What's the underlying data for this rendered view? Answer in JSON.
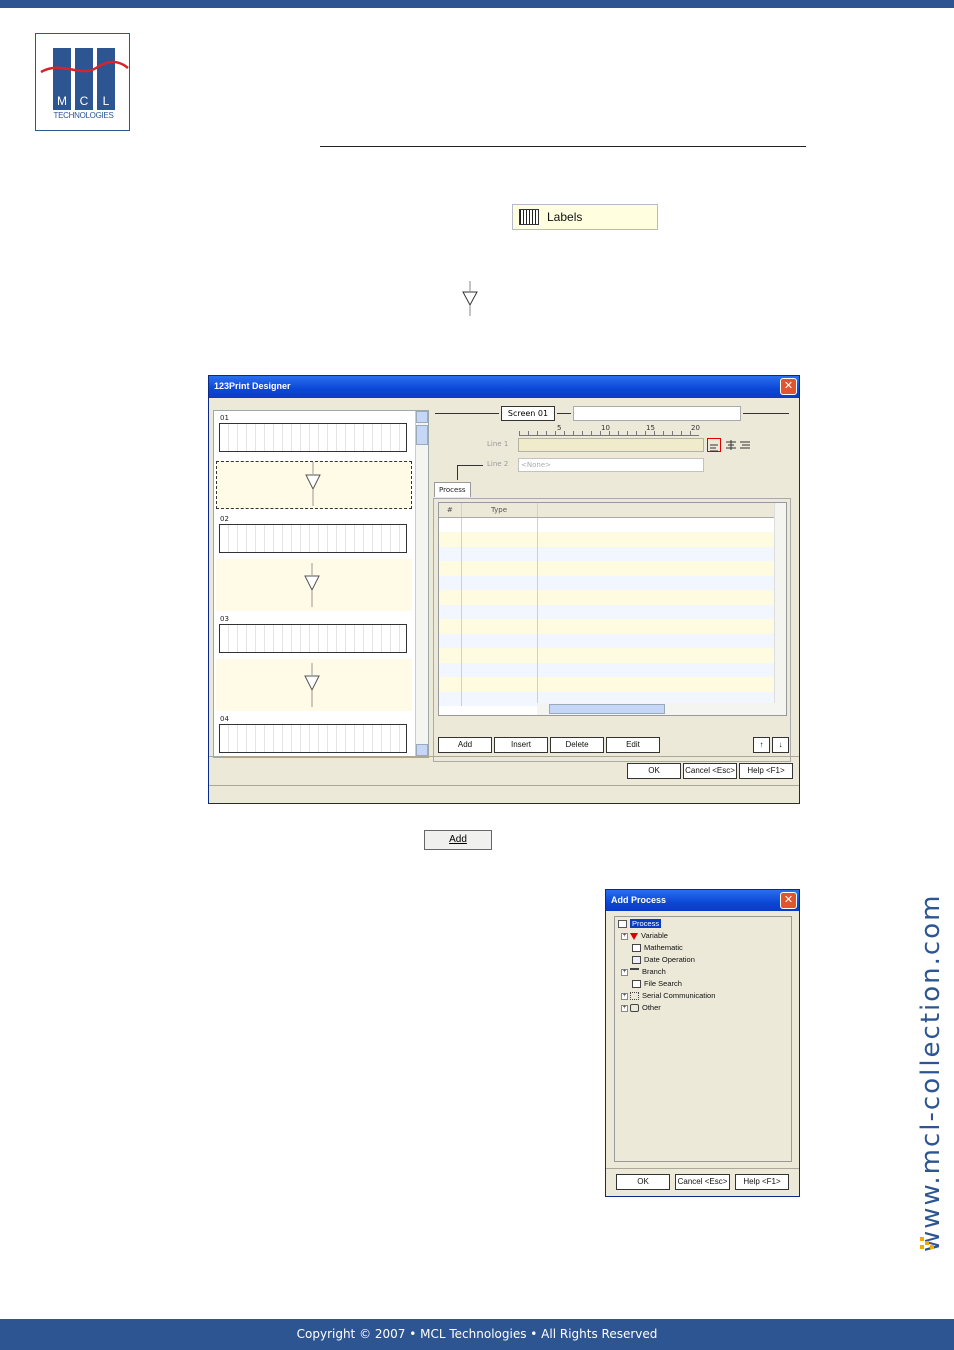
{
  "logo": {
    "letters": [
      "M",
      "C",
      "L"
    ],
    "sub": "TECHNOLOGIES"
  },
  "labels_button": {
    "label": "Labels"
  },
  "designer": {
    "title": "123Print Designer",
    "screens": [
      {
        "num": "01"
      },
      {
        "num": "02"
      },
      {
        "num": "03"
      },
      {
        "num": "04"
      }
    ],
    "screen_tab": "Screen 01",
    "ruler_ticks": [
      "5",
      "10",
      "15",
      "20"
    ],
    "line1_label": "Line 1",
    "line2_label": "Line 2",
    "line2_value": "<None>",
    "process_tab": "Process",
    "grid_headers": [
      "#",
      "Type"
    ],
    "buttons": {
      "add": "Add",
      "insert": "Insert",
      "delete": "Delete",
      "edit": "Edit",
      "ok": "OK",
      "cancel": "Cancel <Esc>",
      "help": "Help <F1>"
    }
  },
  "add_button": {
    "label": "Add"
  },
  "add_process": {
    "title": "Add Process",
    "root": "Process",
    "items": [
      "Variable",
      "Mathematic",
      "Date Operation",
      "Branch",
      "File Search",
      "Serial Communication",
      "Other"
    ],
    "buttons": {
      "ok": "OK",
      "cancel": "Cancel <Esc>",
      "help": "Help <F1>"
    }
  },
  "side_url": "www.mcl-collection.com",
  "footer": "Copyright © 2007 • MCL Technologies • All Rights Reserved",
  "colors": {
    "brand": "#2d5592",
    "accent": "#f5a800",
    "highlight": "#ffffe0"
  }
}
